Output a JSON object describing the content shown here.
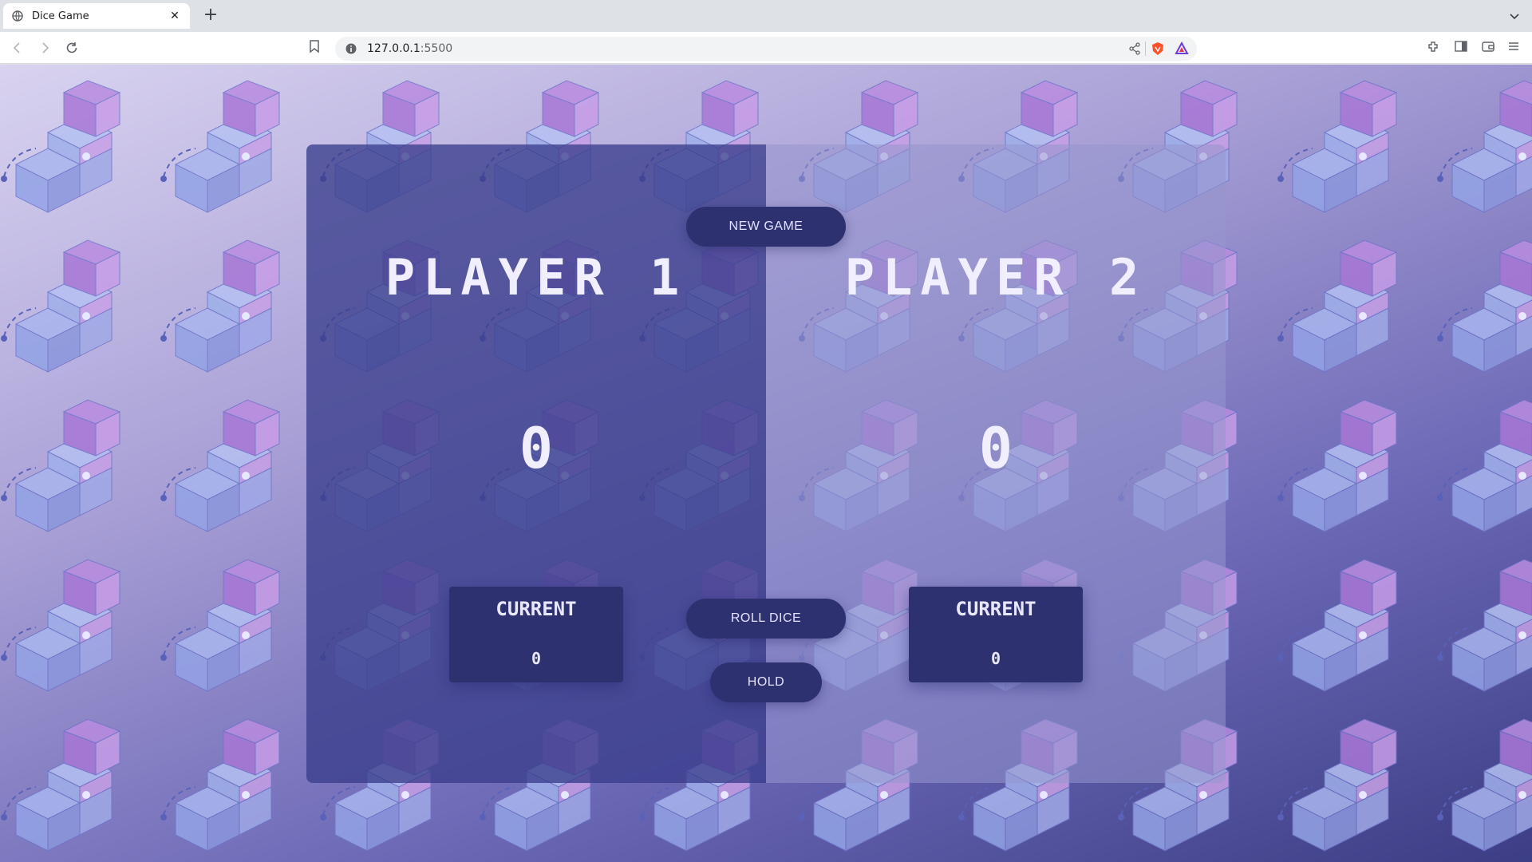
{
  "browser": {
    "tab_title": "Dice Game",
    "url_host": "127.0.0.1",
    "url_port": ":5500",
    "icons": [
      "globe-icon",
      "close-icon",
      "plus-icon",
      "chevron-down-icon",
      "back-icon",
      "forward-icon",
      "reload-icon",
      "bookmark-icon",
      "info-icon",
      "share-icon",
      "brave-shield-icon",
      "brave-rewards-icon",
      "extensions-icon",
      "sidebar-icon",
      "wallet-icon",
      "menu-icon"
    ]
  },
  "game": {
    "new_game_label": "NEW GAME",
    "roll_dice_label": "ROLL DICE",
    "hold_label": "HOLD",
    "players": [
      {
        "name": "PLAYER 1",
        "score": "0",
        "current_label": "CURRENT",
        "current_score": "0",
        "active": true
      },
      {
        "name": "PLAYER 2",
        "score": "0",
        "current_label": "CURRENT",
        "current_score": "0",
        "active": false
      }
    ]
  },
  "colors": {
    "active_panel": "#3a3e8c",
    "button": "#2e3170",
    "text": "#f1efff"
  }
}
